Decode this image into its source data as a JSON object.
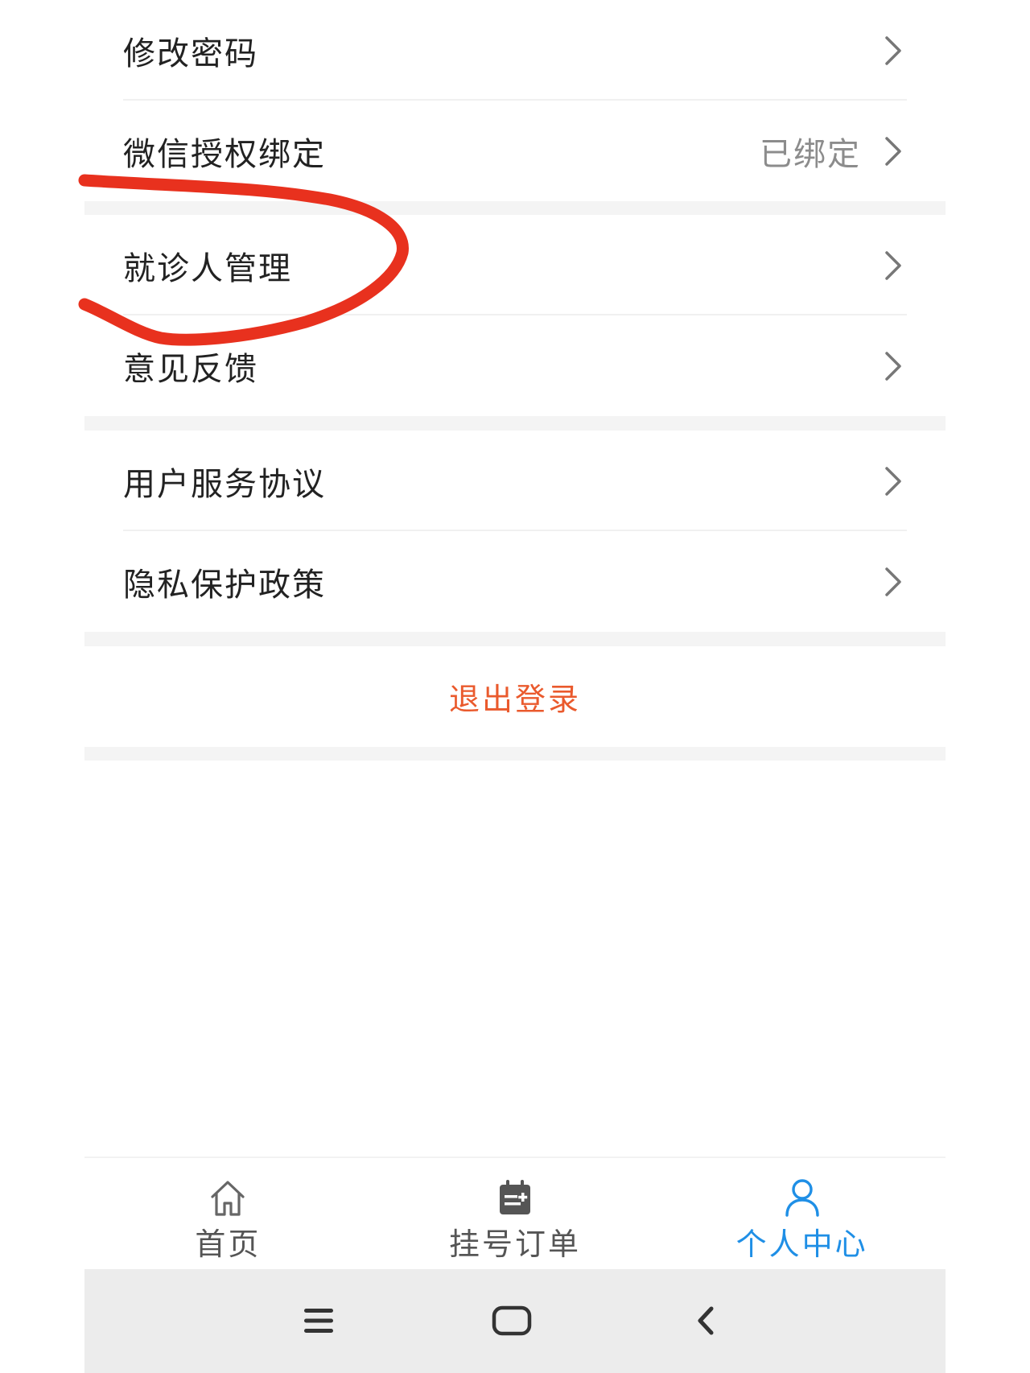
{
  "settings": {
    "group1": [
      {
        "label": "修改密码",
        "value": ""
      },
      {
        "label": "微信授权绑定",
        "value": "已绑定"
      }
    ],
    "group2": [
      {
        "label": "就诊人管理",
        "value": ""
      },
      {
        "label": "意见反馈",
        "value": ""
      }
    ],
    "group3": [
      {
        "label": "用户服务协议",
        "value": ""
      },
      {
        "label": "隐私保护政策",
        "value": ""
      }
    ],
    "logout_label": "退出登录"
  },
  "tabbar": {
    "items": [
      {
        "label": "首页",
        "icon": "home-icon",
        "active": false
      },
      {
        "label": "挂号订单",
        "icon": "calendar-icon",
        "active": false
      },
      {
        "label": "个人中心",
        "icon": "person-icon",
        "active": true
      }
    ]
  },
  "system_nav": {
    "icons": [
      "menu-icon",
      "home-square-icon",
      "back-icon"
    ]
  },
  "colors": {
    "accent": "#1f8fe6",
    "logout": "#ea5a2d",
    "annotation": "#e8311e",
    "separator": "#f4f4f4"
  }
}
